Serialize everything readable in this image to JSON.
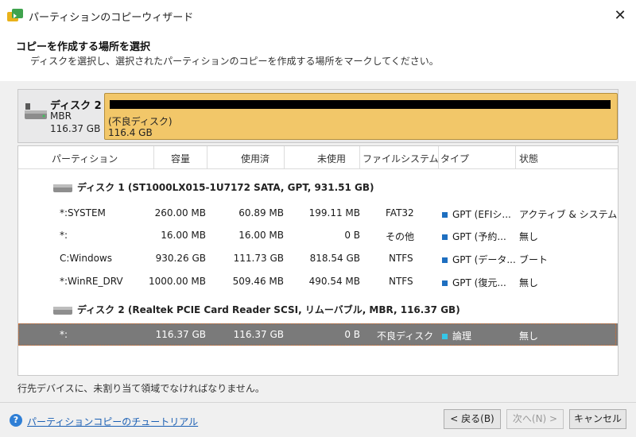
{
  "window": {
    "title": "パーティションのコピーウィザード",
    "close_glyph": "✕"
  },
  "header": {
    "title": "コピーを作成する場所を選択",
    "subtitle": "ディスクを選択し、選択されたパーティションのコピーを作成する場所をマークしてください。"
  },
  "target_disk": {
    "name": "ディスク 2",
    "type": "MBR",
    "size": "116.37 GB",
    "bar_label": "(不良ディスク)",
    "bar_size": "116.4 GB",
    "bar_color": "#f2c769"
  },
  "table": {
    "columns": [
      "パーティション",
      "容量",
      "使用済",
      "未使用",
      "ファイルシステム",
      "タイプ",
      "状態"
    ],
    "disks": [
      {
        "label": "ディスク 1 (ST1000LX015-1U7172 SATA, GPT, 931.51 GB)",
        "partitions": [
          {
            "name": "*:SYSTEM",
            "capacity": "260.00 MB",
            "used": "60.89 MB",
            "unused": "199.11 MB",
            "fs": "FAT32",
            "type": "GPT (EFIシ...",
            "status": "アクティブ & システム"
          },
          {
            "name": "*:",
            "capacity": "16.00 MB",
            "used": "16.00 MB",
            "unused": "0 B",
            "fs": "その他",
            "type": "GPT (予約...",
            "status": "無し"
          },
          {
            "name": "C:Windows",
            "capacity": "930.26 GB",
            "used": "111.73 GB",
            "unused": "818.54 GB",
            "fs": "NTFS",
            "type": "GPT (データ...",
            "status": "ブート"
          },
          {
            "name": "*:WinRE_DRV",
            "capacity": "1000.00 MB",
            "used": "509.46 MB",
            "unused": "490.54 MB",
            "fs": "NTFS",
            "type": "GPT (復元...",
            "status": "無し"
          }
        ]
      },
      {
        "label": "ディスク 2 (Realtek PCIE Card Reader SCSI, リムーバブル, MBR, 116.37 GB)",
        "partitions": [
          {
            "name": "*:",
            "capacity": "116.37 GB",
            "used": "116.37 GB",
            "unused": "0 B",
            "fs": "不良ディスク",
            "type": "論理",
            "status": "無し",
            "selected": true
          }
        ]
      }
    ]
  },
  "status_text": "行先デバイスに、未割り当て領域でなければなりません。",
  "footer": {
    "help_glyph": "?",
    "help_link": "パーティションコピーのチュートリアル",
    "back_button": "< 戻る(B)",
    "next_button": "次へ(N) >",
    "cancel_button": "キャンセル"
  }
}
